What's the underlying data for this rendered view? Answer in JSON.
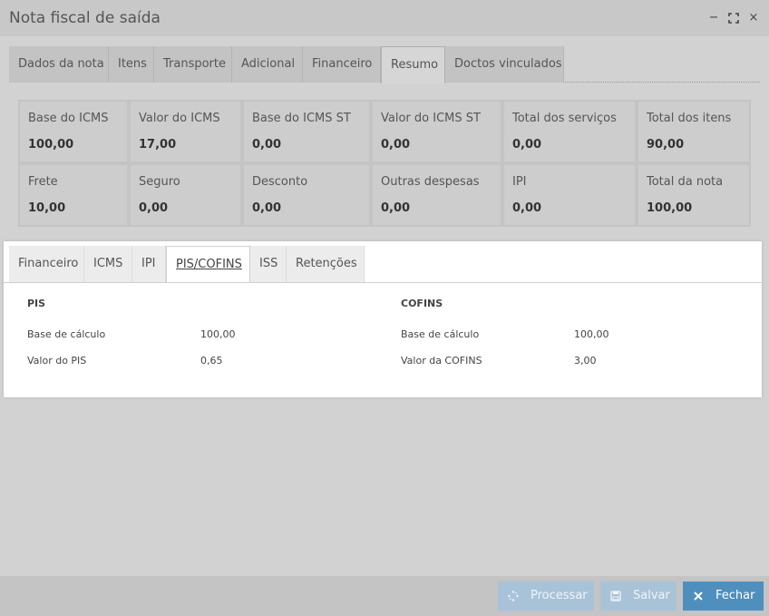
{
  "window": {
    "title": "Nota fiscal de saída",
    "controls": {
      "minimize_icon": "−",
      "maximize_icon": "⛶",
      "close_icon": "×"
    }
  },
  "main_tabs": [
    {
      "label": "Dados da nota"
    },
    {
      "label": "Itens"
    },
    {
      "label": "Transporte"
    },
    {
      "label": "Adicional"
    },
    {
      "label": "Financeiro"
    },
    {
      "label": "Resumo",
      "active": true
    },
    {
      "label": "Doctos vinculados"
    }
  ],
  "summary": {
    "row1": [
      {
        "label": "Base do ICMS",
        "value": "100,00"
      },
      {
        "label": "Valor do ICMS",
        "value": "17,00"
      },
      {
        "label": "Base do ICMS ST",
        "value": "0,00"
      },
      {
        "label": "Valor do ICMS ST",
        "value": "0,00"
      },
      {
        "label": "Total dos serviços",
        "value": "0,00"
      },
      {
        "label": "Total dos itens",
        "value": "90,00"
      }
    ],
    "row2": [
      {
        "label": "Frete",
        "value": "10,00"
      },
      {
        "label": "Seguro",
        "value": "0,00"
      },
      {
        "label": "Desconto",
        "value": "0,00"
      },
      {
        "label": "Outras despesas",
        "value": "0,00"
      },
      {
        "label": "IPI",
        "value": "0,00"
      },
      {
        "label": "Total da nota",
        "value": "100,00"
      }
    ]
  },
  "sub_tabs": [
    {
      "label": "Financeiro"
    },
    {
      "label": "ICMS"
    },
    {
      "label": "IPI"
    },
    {
      "label": "PIS/COFINS",
      "active": true
    },
    {
      "label": "ISS"
    },
    {
      "label": "Retenções"
    }
  ],
  "pis": {
    "title": "PIS",
    "rows": [
      {
        "label": "Base de cálculo",
        "value": "100,00"
      },
      {
        "label": "Valor do PIS",
        "value": "0,65"
      }
    ]
  },
  "cofins": {
    "title": "COFINS",
    "rows": [
      {
        "label": "Base de cálculo",
        "value": "100,00"
      },
      {
        "label": "Valor da COFINS",
        "value": "3,00"
      }
    ]
  },
  "footer": {
    "processar": {
      "label": "Processar",
      "icon": "spinner-icon"
    },
    "salvar": {
      "label": "Salvar",
      "icon": "save-icon"
    },
    "fechar": {
      "label": "Fechar",
      "icon": "close-icon"
    }
  },
  "colors": {
    "primary_button": "#4f8fbe",
    "disabled_button": "#a8c3d8",
    "overlay_gray": "#d2d2d2"
  }
}
